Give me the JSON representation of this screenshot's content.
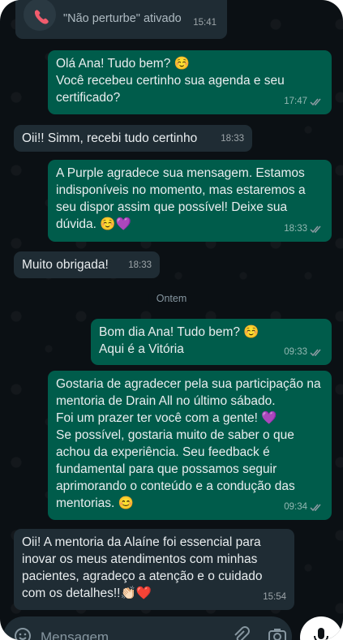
{
  "system": {
    "label": "\"Não perturbe\" ativado",
    "time": "15:41",
    "icon": "missed-call-icon"
  },
  "day_divider": "Ontem",
  "messages": [
    {
      "id": "m1",
      "dir": "out",
      "text": "Olá Ana! Tudo bem? ☺️\nVocê recebeu certinho sua agenda e seu certificado?",
      "time": "17:47",
      "read": true
    },
    {
      "id": "m2",
      "dir": "in",
      "text": "Oii!! Simm, recebi tudo certinho",
      "time": "18:33"
    },
    {
      "id": "m3",
      "dir": "out",
      "text": "A Purple agradece sua mensagem. Estamos indisponíveis no momento, mas estaremos a seu dispor assim que possível! Deixe sua dúvida. ☺️💜",
      "time": "18:33",
      "read": true
    },
    {
      "id": "m4",
      "dir": "in",
      "text": "Muito obrigada!",
      "time": "18:33"
    },
    {
      "id": "m5",
      "dir": "out",
      "text": "Bom dia Ana! Tudo bem? ☺️\nAqui é a Vitória",
      "time": "09:33",
      "read": true
    },
    {
      "id": "m6",
      "dir": "out",
      "text": "Gostaria de agradecer pela sua participação na mentoria de Drain All no último sábado.\nFoi um prazer ter você com a gente! 💜\nSe possível, gostaria muito de saber o que achou da experiência. Seu feedback é fundamental para que possamos seguir aprimorando o conteúdo e a condução das mentorias. 😊",
      "time": "09:34",
      "read": true
    },
    {
      "id": "m7",
      "dir": "in",
      "text": "Oii! A mentoria da Alaíne foi essencial para inovar os meus atendimentos com minhas pacientes, agradeço a atenção e o cuidado com os detalhes!!👏🏻❤️",
      "time": "15:54"
    }
  ],
  "composer": {
    "placeholder": "Mensagem",
    "icons": [
      "emoji-icon",
      "attach-icon",
      "camera-icon",
      "mic-icon"
    ]
  },
  "colors": {
    "incoming": "#1f2c34",
    "outgoing": "#005c4b",
    "background": "#0b1014",
    "read_ticks": "#8e9ba3"
  }
}
